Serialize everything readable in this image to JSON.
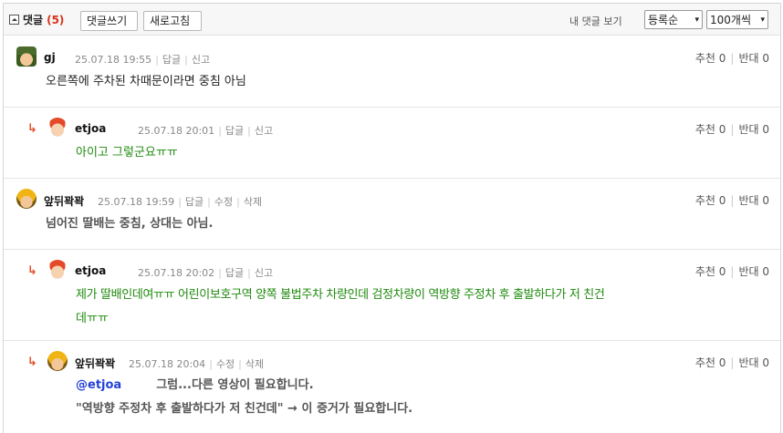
{
  "header": {
    "title": "댓글",
    "count": "(5)",
    "write_button": "댓글쓰기",
    "refresh_button": "새로고침",
    "my_comments": "내 댓글 보기",
    "order_select": "등록순",
    "page_size_select": "100개씩"
  },
  "comments": [
    {
      "nickname": "gj",
      "avatar": "soldier-avatar",
      "date": "25.07.18 19:55",
      "actions": [
        "답글",
        "신고"
      ],
      "recommend": "추천 0",
      "oppose": "반대 0",
      "lines": [
        "오른쪽에 주차된 차때문이라면 중침 아님"
      ]
    },
    {
      "nickname": "etjoa",
      "avatar": "kid-avatar",
      "date": "25.07.18 20:01",
      "actions": [
        "답글",
        "신고"
      ],
      "recommend": "추천 0",
      "oppose": "반대 0",
      "lines": [
        "아이고 그렇군요ㅠㅠ"
      ]
    },
    {
      "nickname": "앞뒤꽉꽉",
      "avatar": "helmet-avatar",
      "date": "25.07.18 19:59",
      "actions": [
        "답글",
        "수정",
        "삭제"
      ],
      "recommend": "추천 0",
      "oppose": "반대 0",
      "lines": [
        "넘어진 딸배는 중침, 상대는 아님."
      ]
    },
    {
      "nickname": "etjoa",
      "avatar": "kid-avatar",
      "date": "25.07.18 20:02",
      "actions": [
        "답글",
        "신고"
      ],
      "recommend": "추천 0",
      "oppose": "반대 0",
      "lines": [
        "제가 딸배인데여ㅠㅠ 어린이보호구역 양쪽 불법주차 차량인데 검정차량이 역방향 주정차 후 출발하다가 저 친건",
        "데ㅠㅠ"
      ]
    },
    {
      "nickname": "앞뒤꽉꽉",
      "avatar": "helmet-avatar",
      "date": "25.07.18 20:04",
      "actions": [
        "수정",
        "삭제"
      ],
      "recommend": "추천 0",
      "oppose": "반대 0",
      "mention": "@etjoa",
      "lines": [
        "그럼...다른 영상이 필요합니다.",
        "\"역방향 주정차 후 출발하다가 저 친건데\" → 이 증거가 필요합니다."
      ]
    }
  ],
  "symbols": {
    "reply_arrow": "↳",
    "caret": "▾"
  }
}
